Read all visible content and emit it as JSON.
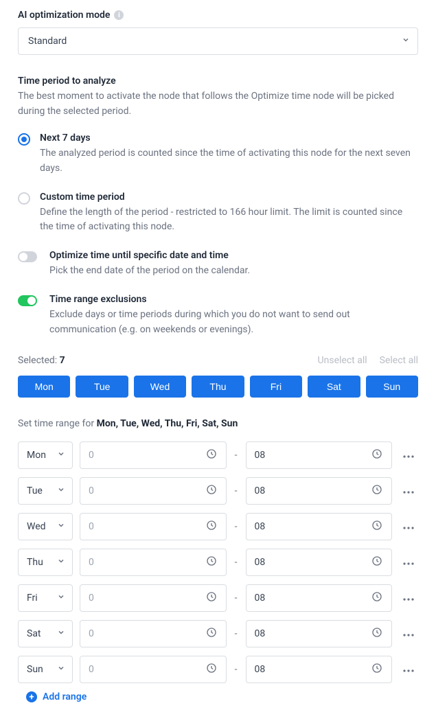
{
  "ai_mode": {
    "label": "AI optimization mode",
    "value": "Standard"
  },
  "time_period": {
    "title": "Time period to analyze",
    "desc": "The best moment to activate the node that follows the Optimize time node will be picked during the selected period.",
    "options": [
      {
        "label": "Next 7 days",
        "desc": "The analyzed period is counted since the time of activating this node for the next seven days.",
        "checked": true
      },
      {
        "label": "Custom time period",
        "desc": "Define the length of the period - restricted to 166 hour limit. The limit is counted since the time of activating this node.",
        "checked": false
      }
    ]
  },
  "toggles": {
    "optimize_until": {
      "label": "Optimize time until specific date and time",
      "desc": "Pick the end date of the period on the calendar.",
      "on": false
    },
    "exclusions": {
      "label": "Time range exclusions",
      "desc": "Exclude days or time periods during which you do not want to send out communication (e.g. on weekends or evenings).",
      "on": true
    }
  },
  "selection": {
    "selected_label": "Selected:",
    "count": "7",
    "unselect_all": "Unselect all",
    "select_all": "Select all",
    "days": [
      "Mon",
      "Tue",
      "Wed",
      "Thu",
      "Fri",
      "Sat",
      "Sun"
    ]
  },
  "range_header": {
    "prefix": "Set time range for ",
    "days_text": "Mon, Tue, Wed, Thu, Fri, Sat, Sun"
  },
  "time_rows": [
    {
      "day": "Mon",
      "from": "0",
      "to": "08"
    },
    {
      "day": "Tue",
      "from": "0",
      "to": "08"
    },
    {
      "day": "Wed",
      "from": "0",
      "to": "08"
    },
    {
      "day": "Thu",
      "from": "0",
      "to": "08"
    },
    {
      "day": "Fri",
      "from": "0",
      "to": "08"
    },
    {
      "day": "Sat",
      "from": "0",
      "to": "08"
    },
    {
      "day": "Sun",
      "from": "0",
      "to": "08"
    }
  ],
  "add_range": "Add range"
}
